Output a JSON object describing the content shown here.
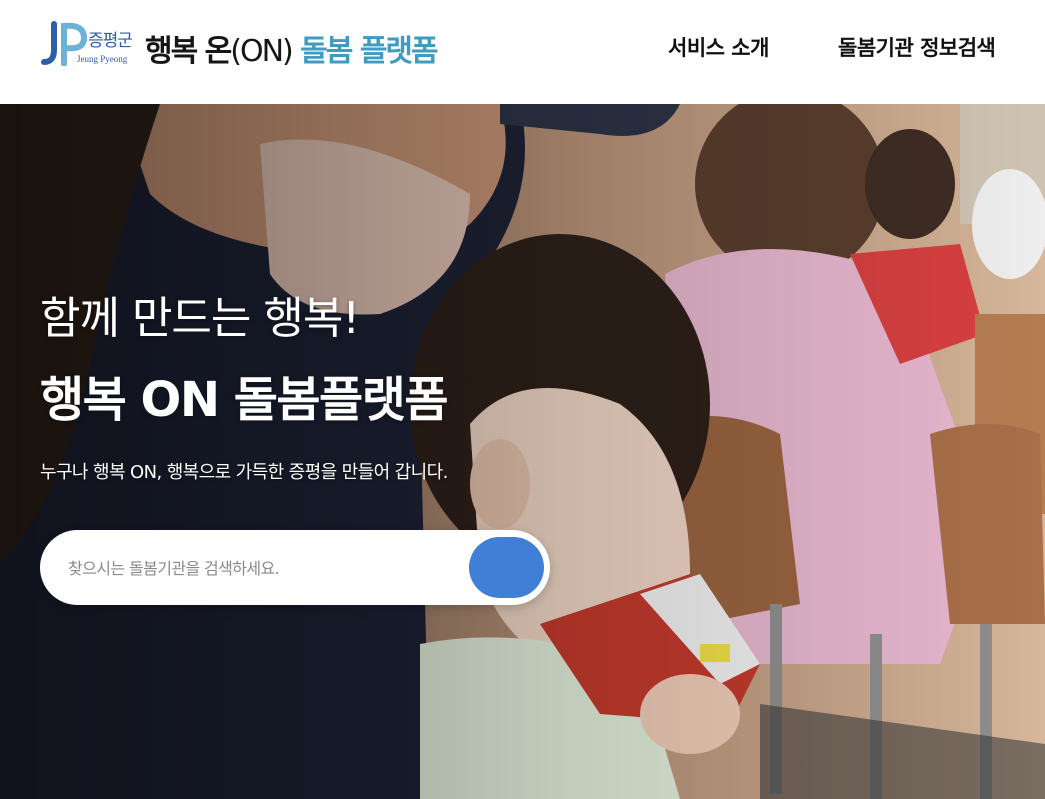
{
  "header": {
    "logo": {
      "mark_text": "JP",
      "region_kor": "증평군",
      "region_eng": "Jeung Pyeong",
      "title_part1": "행복 온",
      "title_part2": "(ON)",
      "title_part3": "돌봄 플랫폼"
    },
    "nav": [
      {
        "label": "서비스 소개"
      },
      {
        "label": "돌봄기관 정보검색"
      }
    ]
  },
  "hero": {
    "headline_light": "함께 만드는 행복!",
    "headline_bold": "행복 ON 돌봄플랫폼",
    "subtitle": "누구나 행복 ON, 행복으로 가득한 증평을 만들어 갑니다.",
    "search": {
      "placeholder": "찾으시는 돌봄기관을 검색하세요.",
      "value": "",
      "button_icon": "search-icon"
    }
  },
  "colors": {
    "accent_blue": "#3f7fd6",
    "logo_teal": "#3f9bbf",
    "logo_blue": "#2f5da8"
  }
}
